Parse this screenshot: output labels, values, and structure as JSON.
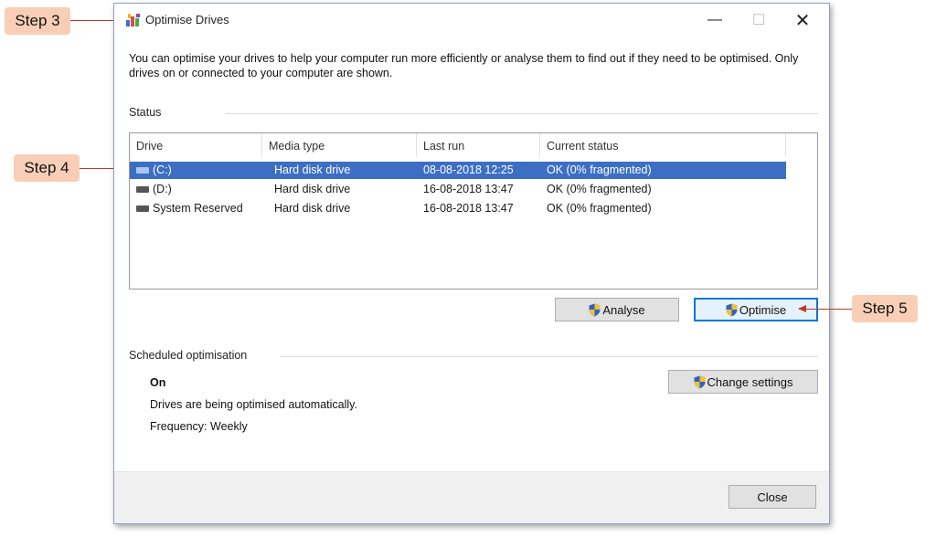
{
  "window": {
    "title": "Optimise Drives",
    "controls": {
      "minimize": "—",
      "maximize": "☐",
      "close": "✕"
    }
  },
  "intro_text": "You can optimise your drives to help your computer run more efficiently or analyse them to find out if they need to be optimised. Only drives on or connected to your computer are shown.",
  "status": {
    "label": "Status",
    "columns": [
      "Drive",
      "Media type",
      "Last run",
      "Current status"
    ],
    "rows": [
      {
        "drive": "(C:)",
        "media_type": "Hard disk drive",
        "last_run": "08-08-2018 12:25",
        "current_status": "OK (0% fragmented)",
        "selected": true
      },
      {
        "drive": "(D:)",
        "media_type": "Hard disk drive",
        "last_run": "16-08-2018 13:47",
        "current_status": "OK (0% fragmented)",
        "selected": false
      },
      {
        "drive": "System Reserved",
        "media_type": "Hard disk drive",
        "last_run": "16-08-2018 13:47",
        "current_status": "OK (0% fragmented)",
        "selected": false
      }
    ]
  },
  "buttons": {
    "analyse": "Analyse",
    "optimise": "Optimise",
    "change_settings": "Change settings",
    "close": "Close"
  },
  "scheduled": {
    "label": "Scheduled optimisation",
    "state": "On",
    "description": "Drives are being optimised automatically.",
    "frequency": "Frequency: Weekly"
  },
  "callouts": {
    "step3": "Step 3",
    "step4": "Step 4",
    "step5": "Step 5"
  },
  "colors": {
    "selection": "#3c6fc4",
    "callout_bg": "#f8cfb6",
    "arrow": "#c0392b"
  },
  "icons": {
    "app": "optimise-drives-icon",
    "drive": "hard-drive-icon",
    "shield": "uac-shield-icon"
  }
}
